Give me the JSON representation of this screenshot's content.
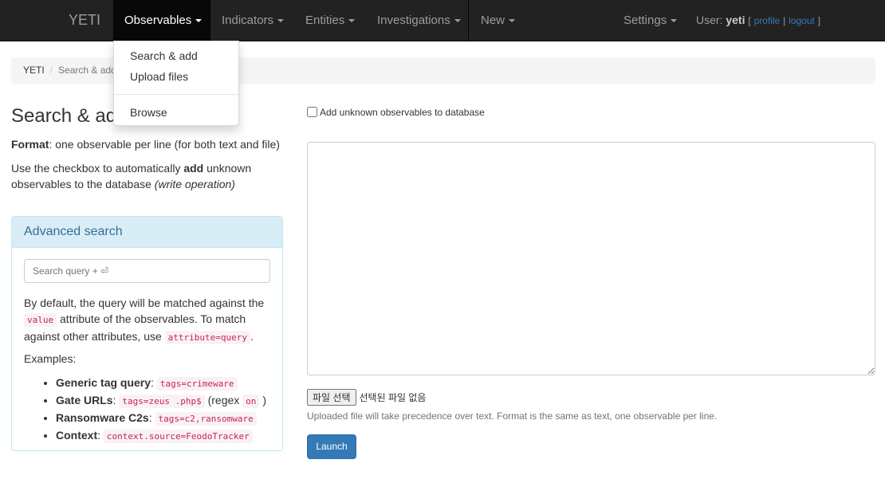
{
  "navbar": {
    "brand": "YETI",
    "items": [
      {
        "label": "Observables",
        "active": true
      },
      {
        "label": "Indicators"
      },
      {
        "label": "Entities"
      },
      {
        "label": "Investigations"
      },
      {
        "label": "New"
      }
    ],
    "settings_label": "Settings",
    "user_prefix": "User:",
    "username": "yeti",
    "open_bracket": "[",
    "profile_label": "profile",
    "pipe": "|",
    "logout_label": "logout",
    "close_bracket": "]"
  },
  "dropdown": {
    "items": [
      "Search & add",
      "Upload files",
      "Browse"
    ]
  },
  "breadcrumb": {
    "root": "YETI",
    "separator": "/",
    "current": "Search & add"
  },
  "page_title": "Search & add",
  "format_line": {
    "bold": "Format",
    "rest": ": one observable per line (for both text and file)"
  },
  "checkbox_help": {
    "part1": "Use the checkbox to automatically ",
    "bold": "add",
    "part2": " unknown observables to the database ",
    "italic": "(write operation)"
  },
  "advanced_search": {
    "title": "Advanced search",
    "placeholder": "Search query + ⏎",
    "desc_part1": "By default, the query will be matched against the ",
    "desc_code1": "value",
    "desc_part2": " attribute of the observables. To match against other attributes, use ",
    "desc_code2": "attribute=query",
    "desc_part3": ".",
    "examples_label": "Examples:",
    "examples": [
      {
        "label": "Generic tag query",
        "sep": ":",
        "code": "tags=crimeware"
      },
      {
        "label": "Gate URLs",
        "sep": ":",
        "code": "tags=zeus .php$",
        "suffix_pre": "(regex",
        "suffix_code": "on",
        "suffix_post": ")"
      },
      {
        "label": "Ransomware C2s",
        "sep": ":",
        "code": "tags=c2,ransomware"
      },
      {
        "label": "Context",
        "sep": ":",
        "code": "context.source=FeodoTracker"
      }
    ]
  },
  "main": {
    "checkbox_label": "Add unknown observables to database",
    "file_button": "파일 선택",
    "file_status": "선택된 파일 없음",
    "upload_help": "Uploaded file will take precedence over text. Format is the same as text, one observable per line.",
    "launch_label": "Launch"
  }
}
